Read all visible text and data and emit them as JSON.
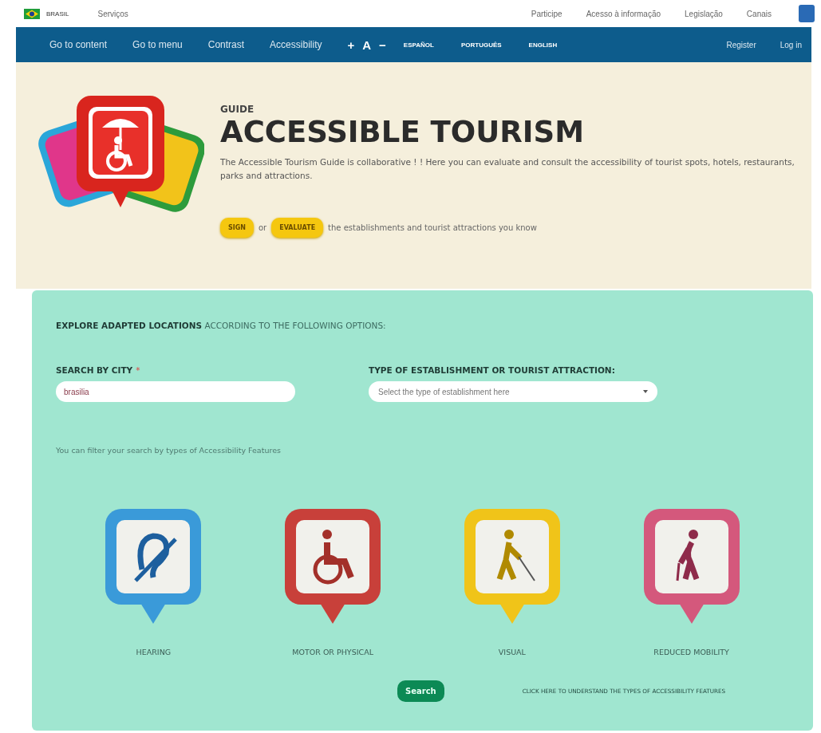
{
  "gov_bar": {
    "country": "BRASIL",
    "services": "Serviços",
    "links": [
      "Participe",
      "Acesso à informação",
      "Legislação",
      "Canais"
    ]
  },
  "nav": {
    "links": [
      "Go to content",
      "Go to menu",
      "Contrast",
      "Accessibility"
    ],
    "font_controls": [
      "+",
      "A",
      "−"
    ],
    "languages": [
      "ESPAÑOL",
      "PORTUGUÊS",
      "ENGLISH"
    ],
    "account": [
      "Register",
      "Log in"
    ]
  },
  "header": {
    "kicker": "GUIDE",
    "title": "ACCESSIBLE TOURISM",
    "description": "The Accessible Tourism Guide is collaborative ! ! Here you can evaluate and consult the accessibility of tourist spots, hotels, restaurants, parks and attractions.",
    "buttons": [
      "SIGN",
      "EVALUATE"
    ],
    "connector": "or",
    "call_to_action": "the establishments and tourist attractions you know"
  },
  "explore": {
    "heading": "**EXPLORE ADAPTED LOCATIONS** ACCORDING TO THE FOLLOWING OPTIONS:",
    "city": {
      "label": "SEARCH BY CITY",
      "required_mark": "*",
      "value": "brasilia"
    },
    "type": {
      "label": "TYPE OF ESTABLISHMENT OR TOURIST ATTRACTION:",
      "placeholder": "Select the type of establishment here"
    },
    "filter_hint": "You can filter your search by types of Accessibility Features",
    "features": [
      {
        "kind": "hearing",
        "label": "HEARING",
        "color": "#3a9ad9"
      },
      {
        "kind": "motor",
        "label": "MOTOR OR PHYSICAL",
        "color": "#c8403a"
      },
      {
        "kind": "visual",
        "label": "VISUAL",
        "color": "#f0c419"
      },
      {
        "kind": "mobility",
        "label": "REDUCED MOBILITY",
        "color": "#d4587c"
      }
    ],
    "search_button": "Search",
    "help_link": "CLICK HERE TO UNDERSTAND THE TYPES OF ACCESSIBILITY FEATURES"
  }
}
